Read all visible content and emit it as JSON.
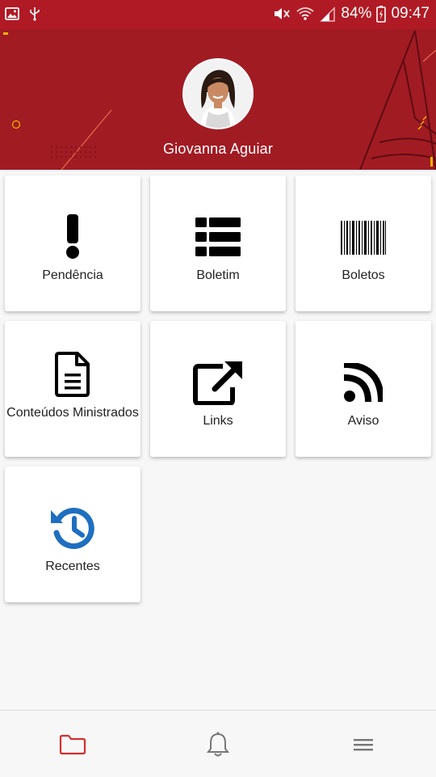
{
  "status_bar": {
    "battery": "84%",
    "time": "09:47",
    "icons": [
      "image-icon",
      "usb-icon",
      "mute-icon",
      "wifi-icon",
      "signal-icon",
      "battery-icon"
    ]
  },
  "header": {
    "user_name": "Giovanna Aguiar",
    "avatar": "avatar-photo",
    "background_color": "#a11b23"
  },
  "menu": [
    {
      "label": "Pendência",
      "icon": "exclamation-icon"
    },
    {
      "label": "Boletim",
      "icon": "table-list-icon"
    },
    {
      "label": "Boletos",
      "icon": "barcode-icon"
    },
    {
      "label": "Conteúdos Ministrados",
      "icon": "document-icon"
    },
    {
      "label": "Links",
      "icon": "external-link-icon"
    },
    {
      "label": "Aviso",
      "icon": "rss-icon"
    },
    {
      "label": "Recentes",
      "icon": "history-icon"
    }
  ],
  "bottom_nav": {
    "items": [
      "folder-icon",
      "bell-icon",
      "menu-icon"
    ],
    "active_color": "#d32f2f",
    "inactive_color": "#777777"
  }
}
